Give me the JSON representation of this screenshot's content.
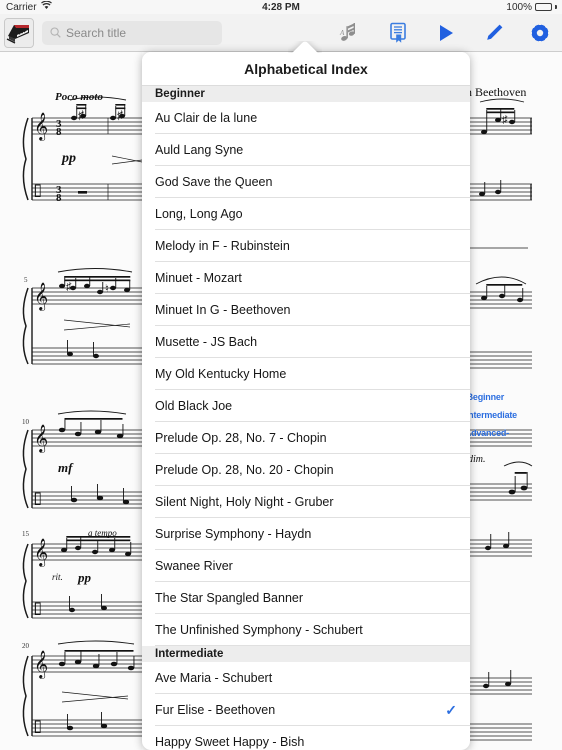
{
  "statusbar": {
    "carrier": "Carrier",
    "wifi_icon": "wifi-icon",
    "time": "4:28 PM",
    "battery_percent": "100%",
    "battery_icon": "battery-full-icon"
  },
  "toolbar": {
    "app_icon": "piano-app-icon",
    "search": {
      "placeholder": "Search title",
      "value": "",
      "icon": "search-icon"
    },
    "buttons": [
      {
        "name": "alphabetical-index-button",
        "icon": "music-notes-icon",
        "label": "Alphabetical Index",
        "color": "#8e8e8e",
        "active": true
      },
      {
        "name": "bookmarks-button",
        "icon": "bookmark-document-icon",
        "label": "Bookmarks",
        "color": "#2d6fe0",
        "active": false
      },
      {
        "name": "play-button",
        "icon": "play-icon",
        "label": "Play",
        "color": "#2160e0",
        "active": false
      },
      {
        "name": "edit-button",
        "icon": "pencil-icon",
        "label": "Edit",
        "color": "#2160e0",
        "active": false
      },
      {
        "name": "settings-button",
        "icon": "gear-icon",
        "label": "Settings",
        "color": "#2160e0",
        "active": false
      }
    ]
  },
  "sheet": {
    "tempo_marking": "Poco moto",
    "dynamics": [
      "pp",
      "mf",
      "pp",
      "dim."
    ],
    "expression": "a tempo",
    "ritard": "rit.",
    "measure_numbers": [
      "5",
      "10",
      "15",
      "20"
    ],
    "composer_partial": "n Beethoven",
    "legend": [
      {
        "label": "Beginner",
        "color": "#2d6fe0"
      },
      {
        "label": "Intermediate",
        "color": "#2d6fe0"
      },
      {
        "label": "-Advanced-",
        "color": "#2d6fe0"
      }
    ]
  },
  "popover": {
    "title": "Alphabetical Index",
    "sections": [
      {
        "header": "Beginner",
        "items": [
          {
            "title": "Au Clair de la lune",
            "selected": false
          },
          {
            "title": "Auld Lang Syne",
            "selected": false
          },
          {
            "title": "God Save the Queen",
            "selected": false
          },
          {
            "title": "Long, Long Ago",
            "selected": false
          },
          {
            "title": "Melody in F - Rubinstein",
            "selected": false
          },
          {
            "title": "Minuet - Mozart",
            "selected": false
          },
          {
            "title": "Minuet In G - Beethoven",
            "selected": false
          },
          {
            "title": "Musette - JS Bach",
            "selected": false
          },
          {
            "title": "My Old Kentucky Home",
            "selected": false
          },
          {
            "title": "Old Black Joe",
            "selected": false
          },
          {
            "title": "Prelude Op. 28, No. 7 - Chopin",
            "selected": false
          },
          {
            "title": "Prelude Op. 28, No. 20 - Chopin",
            "selected": false
          },
          {
            "title": "Silent Night, Holy Night - Gruber",
            "selected": false
          },
          {
            "title": "Surprise Symphony - Haydn",
            "selected": false
          },
          {
            "title": "Swanee River",
            "selected": false
          },
          {
            "title": "The Star Spangled Banner",
            "selected": false
          },
          {
            "title": "The Unfinished Symphony - Schubert",
            "selected": false
          }
        ]
      },
      {
        "header": "Intermediate",
        "items": [
          {
            "title": "Ave Maria - Schubert",
            "selected": false
          },
          {
            "title": "Fur Elise - Beethoven",
            "selected": true
          },
          {
            "title": "Happy Sweet Happy - Bish",
            "selected": false
          }
        ]
      }
    ],
    "checkmark_glyph": "✓",
    "accent_color": "#2d6fe0"
  }
}
